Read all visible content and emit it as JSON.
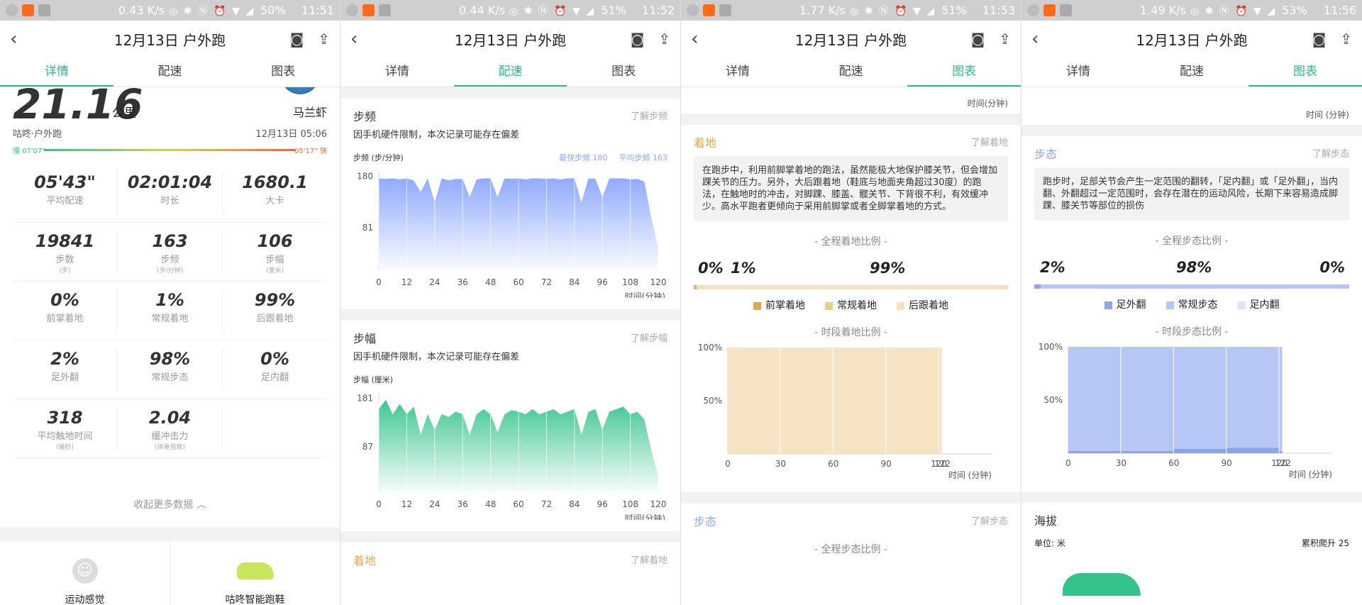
{
  "panels": [
    {
      "status": {
        "speed": "0.43 K/s",
        "battery": "50%",
        "time": "11:51"
      },
      "title": "12月13日 户外跑",
      "tabs": [
        "详情",
        "配速",
        "图表"
      ],
      "active_tab": 0,
      "summary": {
        "distance": "21.16",
        "distance_unit": "公里",
        "user": "马兰虾",
        "type": "咕咚·户外跑",
        "datetime": "12月13日 05:06",
        "pace_slow": "慢 07'07\"",
        "pace_fast": "05'17\" 快"
      },
      "stats": [
        [
          {
            "v": "05'43\"",
            "k": "平均配速"
          },
          {
            "v": "02:01:04",
            "k": "时长"
          },
          {
            "v": "1680.1",
            "k": "大卡"
          }
        ],
        [
          {
            "v": "19841",
            "k": "步数",
            "u": "(步)"
          },
          {
            "v": "163",
            "k": "步频",
            "u": "(步/分钟)"
          },
          {
            "v": "106",
            "k": "步幅",
            "u": "(厘米)"
          }
        ],
        [
          {
            "v": "0%",
            "k": "前掌着地"
          },
          {
            "v": "1%",
            "k": "常规着地"
          },
          {
            "v": "99%",
            "k": "后跟着地"
          }
        ],
        [
          {
            "v": "2%",
            "k": "足外翻"
          },
          {
            "v": "98%",
            "k": "常规步态"
          },
          {
            "v": "0%",
            "k": "足内翻"
          }
        ],
        [
          {
            "v": "318",
            "k": "平均触地时间",
            "u": "(毫秒)"
          },
          {
            "v": "2.04",
            "k": "缓冲击力",
            "u": "(体重倍数)"
          },
          {
            "v": "",
            "k": ""
          }
        ]
      ],
      "collapse": "收起更多数据 ︿",
      "feel": [
        "运动感觉",
        "咕咚智能跑鞋"
      ]
    },
    {
      "status": {
        "speed": "0.44 K/s",
        "battery": "51%",
        "time": "11:52"
      },
      "title": "12月13日 户外跑",
      "tabs": [
        "详情",
        "配速",
        "图表"
      ],
      "active_tab": 1,
      "cadence": {
        "title": "步频",
        "link": "了解步频",
        "desc": "因手机硬件限制，本次记录可能存在偏差",
        "label": "步频 (步/分钟)",
        "fast": "最快步频 180",
        "avg": "平均步频 163",
        "unit": "时间(分钟)"
      },
      "stride": {
        "title": "步幅",
        "link": "了解步幅",
        "desc": "因手机硬件限制，本次记录可能存在偏差",
        "label": "步幅 (厘米)",
        "unit": "时间(分钟)"
      },
      "landing": {
        "title": "着地",
        "link": "了解着地"
      }
    },
    {
      "status": {
        "speed": "1.77 K/s",
        "battery": "51%",
        "time": "11:53"
      },
      "title": "12月13日 户外跑",
      "tabs": [
        "详情",
        "配速",
        "图表"
      ],
      "active_tab": 2,
      "top_unit": "时间(分钟)",
      "landing": {
        "title": "着地",
        "link": "了解着地",
        "info": "在跑步中，利用前脚掌着地的跑法，虽然能极大地保护膝关节，但会增加踝关节的压力。另外，大后跟着地（鞋底与地面夹角超过30度）的跑法，在触地时的冲击，对脚踝、膝盖、髋关节、下背很不利，有效缓冲少。高水平跑者更倾向于采用前脚掌或者全脚掌着地的方式。",
        "whole": "- 全程着地比例 -",
        "pcts": [
          "0%",
          "1%",
          "99%"
        ],
        "legend": [
          "前掌着地",
          "常规着地",
          "后跟着地"
        ],
        "period": "- 时段着地比例 -",
        "unit": "时间 (分钟)"
      },
      "gait": {
        "title": "步态",
        "link": "了解步态",
        "whole": "- 全程步态比例 -"
      }
    },
    {
      "status": {
        "speed": "1.49 K/s",
        "battery": "53%",
        "time": "11:56"
      },
      "title": "12月13日 户外跑",
      "tabs": [
        "详情",
        "配速",
        "图表"
      ],
      "active_tab": 2,
      "top_unit": "时间 (分钟)",
      "gait": {
        "title": "步态",
        "link": "了解步态",
        "info": "跑步时，足部关节会产生一定范围的翻转，「足内翻」或「足外翻」，当内翻、外翻超过一定范围时，会存在潜在的运动风险，长期下来容易造成脚踝、膝关节等部位的损伤",
        "whole": "- 全程步态比例 -",
        "pcts": [
          "2%",
          "98%",
          "0%"
        ],
        "legend": [
          "足外翻",
          "常规步态",
          "足内翻"
        ],
        "period": "- 时段步态比例 -",
        "unit": "时间 (分钟)"
      },
      "altitude": {
        "title": "海拔",
        "unit": "单位: 米",
        "climb": "累积爬升 25"
      }
    }
  ],
  "colors": {
    "accent": "#2cba8a",
    "cadence": "#8aa6ff",
    "stride": "#35c38c",
    "landing": "#e0a84a",
    "gait": "#8aa6e8"
  },
  "chart_data": [
    {
      "type": "area",
      "title": "步频",
      "ylabel": "步频 (步/分钟)",
      "xlabel": "时间(分钟)",
      "x_ticks": [
        0,
        12,
        24,
        36,
        48,
        60,
        72,
        84,
        96,
        108,
        120
      ],
      "y_ticks": [
        81,
        180
      ],
      "x": [
        0,
        3,
        6,
        9,
        12,
        15,
        18,
        21,
        24,
        27,
        30,
        33,
        36,
        39,
        42,
        45,
        48,
        51,
        54,
        57,
        60,
        63,
        66,
        69,
        72,
        75,
        78,
        81,
        84,
        87,
        90,
        93,
        96,
        99,
        102,
        105,
        108,
        111,
        114,
        117,
        120
      ],
      "values": [
        176,
        175,
        176,
        174,
        176,
        172,
        150,
        176,
        130,
        176,
        172,
        175,
        175,
        140,
        174,
        176,
        176,
        140,
        176,
        175,
        176,
        174,
        176,
        176,
        175,
        176,
        174,
        176,
        176,
        130,
        176,
        175,
        140,
        176,
        176,
        176,
        174,
        175,
        170,
        100,
        40
      ]
    },
    {
      "type": "area",
      "title": "步幅",
      "ylabel": "步幅 (厘米)",
      "xlabel": "时间(分钟)",
      "x_ticks": [
        0,
        12,
        24,
        36,
        48,
        60,
        72,
        84,
        96,
        108,
        120
      ],
      "y_ticks": [
        87,
        181
      ],
      "x": [
        0,
        3,
        6,
        9,
        12,
        15,
        18,
        21,
        24,
        27,
        30,
        33,
        36,
        39,
        42,
        45,
        48,
        51,
        54,
        57,
        60,
        63,
        66,
        69,
        72,
        75,
        78,
        81,
        84,
        87,
        90,
        93,
        96,
        99,
        102,
        105,
        108,
        111,
        114,
        117,
        120
      ],
      "values": [
        160,
        178,
        150,
        170,
        150,
        165,
        110,
        150,
        120,
        150,
        145,
        155,
        150,
        110,
        150,
        160,
        150,
        115,
        150,
        158,
        155,
        150,
        160,
        150,
        155,
        160,
        150,
        155,
        160,
        110,
        155,
        160,
        120,
        155,
        160,
        165,
        150,
        155,
        140,
        80,
        30
      ]
    },
    {
      "type": "bar",
      "title": "时段着地比例",
      "xlabel": "时间 (分钟)",
      "categories": [
        "0-30",
        "30-60",
        "60-90",
        "90-120",
        "120-122"
      ],
      "x_ticks": [
        0,
        30,
        60,
        90,
        120,
        122
      ],
      "y_ticks": [
        "50%",
        "100%"
      ],
      "series": [
        {
          "name": "后跟着地",
          "values": [
            100,
            100,
            100,
            100,
            100
          ]
        }
      ]
    },
    {
      "type": "bar",
      "title": "时段步态比例",
      "xlabel": "时间 (分钟)",
      "categories": [
        "0-30",
        "30-60",
        "60-90",
        "90-120",
        "120-122"
      ],
      "x_ticks": [
        0,
        30,
        60,
        90,
        120,
        122
      ],
      "y_ticks": [
        "50%",
        "100%"
      ],
      "series": [
        {
          "name": "足外翻",
          "values": [
            2,
            2,
            4,
            5,
            2
          ]
        },
        {
          "name": "常规步态",
          "values": [
            98,
            98,
            96,
            95,
            98
          ]
        }
      ]
    }
  ]
}
